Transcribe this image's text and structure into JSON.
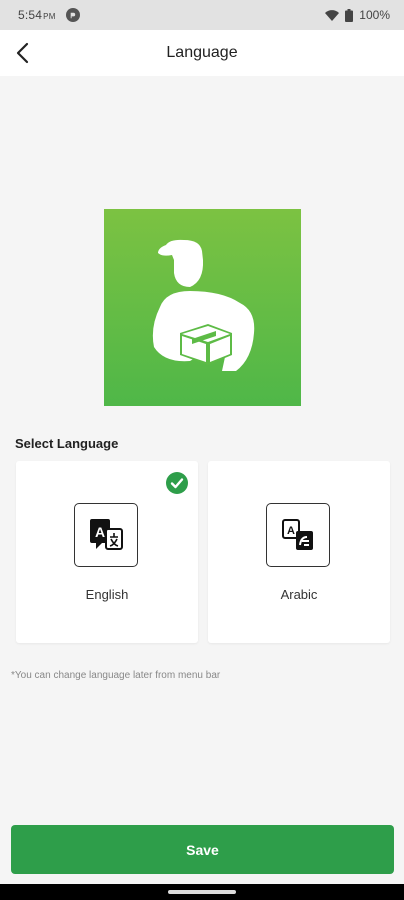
{
  "status_bar": {
    "time": "5:54",
    "ampm": "PM",
    "battery": "100%"
  },
  "header": {
    "title": "Language",
    "back_icon": "chevron-left-icon"
  },
  "hero": {
    "icon": "delivery-man-icon",
    "background": "#5dbb46"
  },
  "select_language": {
    "label": "Select Language",
    "options": [
      {
        "label": "English",
        "selected": true,
        "icon": "translate-icon"
      },
      {
        "label": "Arabic",
        "selected": false,
        "icon": "translate-icon"
      }
    ]
  },
  "hint": "*You can change language later from menu bar",
  "save_button": {
    "label": "Save"
  },
  "colors": {
    "accent": "#2e9e4a",
    "check": "#2e9e4a"
  }
}
